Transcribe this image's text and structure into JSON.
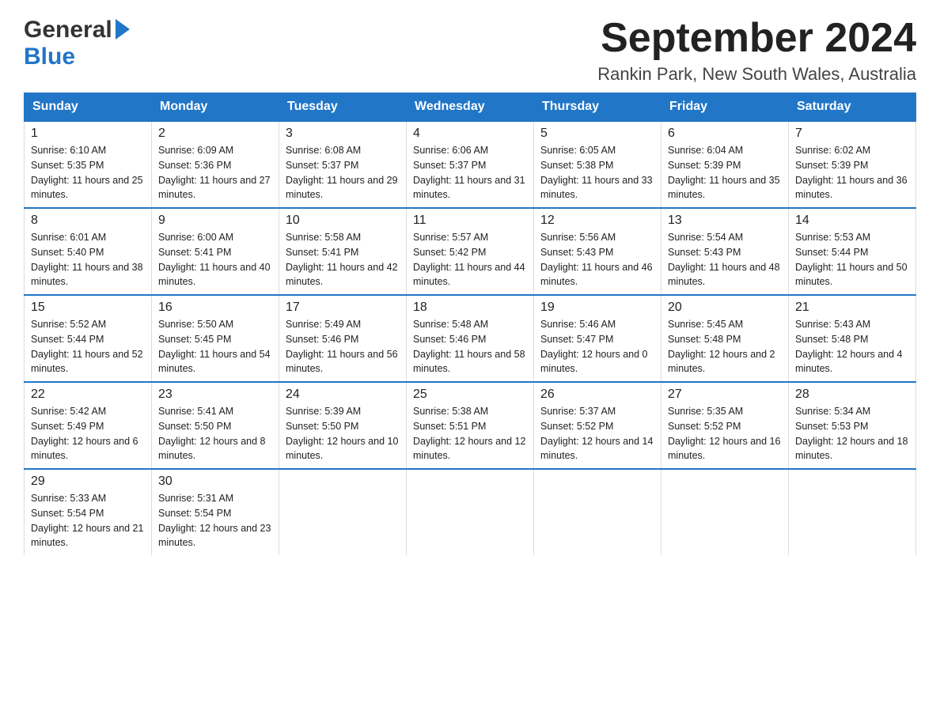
{
  "logo": {
    "general": "General",
    "blue": "Blue",
    "triangle": "▶"
  },
  "title": {
    "month_year": "September 2024",
    "location": "Rankin Park, New South Wales, Australia"
  },
  "weekdays": [
    "Sunday",
    "Monday",
    "Tuesday",
    "Wednesday",
    "Thursday",
    "Friday",
    "Saturday"
  ],
  "weeks": [
    [
      {
        "day": "1",
        "sunrise": "Sunrise: 6:10 AM",
        "sunset": "Sunset: 5:35 PM",
        "daylight": "Daylight: 11 hours and 25 minutes."
      },
      {
        "day": "2",
        "sunrise": "Sunrise: 6:09 AM",
        "sunset": "Sunset: 5:36 PM",
        "daylight": "Daylight: 11 hours and 27 minutes."
      },
      {
        "day": "3",
        "sunrise": "Sunrise: 6:08 AM",
        "sunset": "Sunset: 5:37 PM",
        "daylight": "Daylight: 11 hours and 29 minutes."
      },
      {
        "day": "4",
        "sunrise": "Sunrise: 6:06 AM",
        "sunset": "Sunset: 5:37 PM",
        "daylight": "Daylight: 11 hours and 31 minutes."
      },
      {
        "day": "5",
        "sunrise": "Sunrise: 6:05 AM",
        "sunset": "Sunset: 5:38 PM",
        "daylight": "Daylight: 11 hours and 33 minutes."
      },
      {
        "day": "6",
        "sunrise": "Sunrise: 6:04 AM",
        "sunset": "Sunset: 5:39 PM",
        "daylight": "Daylight: 11 hours and 35 minutes."
      },
      {
        "day": "7",
        "sunrise": "Sunrise: 6:02 AM",
        "sunset": "Sunset: 5:39 PM",
        "daylight": "Daylight: 11 hours and 36 minutes."
      }
    ],
    [
      {
        "day": "8",
        "sunrise": "Sunrise: 6:01 AM",
        "sunset": "Sunset: 5:40 PM",
        "daylight": "Daylight: 11 hours and 38 minutes."
      },
      {
        "day": "9",
        "sunrise": "Sunrise: 6:00 AM",
        "sunset": "Sunset: 5:41 PM",
        "daylight": "Daylight: 11 hours and 40 minutes."
      },
      {
        "day": "10",
        "sunrise": "Sunrise: 5:58 AM",
        "sunset": "Sunset: 5:41 PM",
        "daylight": "Daylight: 11 hours and 42 minutes."
      },
      {
        "day": "11",
        "sunrise": "Sunrise: 5:57 AM",
        "sunset": "Sunset: 5:42 PM",
        "daylight": "Daylight: 11 hours and 44 minutes."
      },
      {
        "day": "12",
        "sunrise": "Sunrise: 5:56 AM",
        "sunset": "Sunset: 5:43 PM",
        "daylight": "Daylight: 11 hours and 46 minutes."
      },
      {
        "day": "13",
        "sunrise": "Sunrise: 5:54 AM",
        "sunset": "Sunset: 5:43 PM",
        "daylight": "Daylight: 11 hours and 48 minutes."
      },
      {
        "day": "14",
        "sunrise": "Sunrise: 5:53 AM",
        "sunset": "Sunset: 5:44 PM",
        "daylight": "Daylight: 11 hours and 50 minutes."
      }
    ],
    [
      {
        "day": "15",
        "sunrise": "Sunrise: 5:52 AM",
        "sunset": "Sunset: 5:44 PM",
        "daylight": "Daylight: 11 hours and 52 minutes."
      },
      {
        "day": "16",
        "sunrise": "Sunrise: 5:50 AM",
        "sunset": "Sunset: 5:45 PM",
        "daylight": "Daylight: 11 hours and 54 minutes."
      },
      {
        "day": "17",
        "sunrise": "Sunrise: 5:49 AM",
        "sunset": "Sunset: 5:46 PM",
        "daylight": "Daylight: 11 hours and 56 minutes."
      },
      {
        "day": "18",
        "sunrise": "Sunrise: 5:48 AM",
        "sunset": "Sunset: 5:46 PM",
        "daylight": "Daylight: 11 hours and 58 minutes."
      },
      {
        "day": "19",
        "sunrise": "Sunrise: 5:46 AM",
        "sunset": "Sunset: 5:47 PM",
        "daylight": "Daylight: 12 hours and 0 minutes."
      },
      {
        "day": "20",
        "sunrise": "Sunrise: 5:45 AM",
        "sunset": "Sunset: 5:48 PM",
        "daylight": "Daylight: 12 hours and 2 minutes."
      },
      {
        "day": "21",
        "sunrise": "Sunrise: 5:43 AM",
        "sunset": "Sunset: 5:48 PM",
        "daylight": "Daylight: 12 hours and 4 minutes."
      }
    ],
    [
      {
        "day": "22",
        "sunrise": "Sunrise: 5:42 AM",
        "sunset": "Sunset: 5:49 PM",
        "daylight": "Daylight: 12 hours and 6 minutes."
      },
      {
        "day": "23",
        "sunrise": "Sunrise: 5:41 AM",
        "sunset": "Sunset: 5:50 PM",
        "daylight": "Daylight: 12 hours and 8 minutes."
      },
      {
        "day": "24",
        "sunrise": "Sunrise: 5:39 AM",
        "sunset": "Sunset: 5:50 PM",
        "daylight": "Daylight: 12 hours and 10 minutes."
      },
      {
        "day": "25",
        "sunrise": "Sunrise: 5:38 AM",
        "sunset": "Sunset: 5:51 PM",
        "daylight": "Daylight: 12 hours and 12 minutes."
      },
      {
        "day": "26",
        "sunrise": "Sunrise: 5:37 AM",
        "sunset": "Sunset: 5:52 PM",
        "daylight": "Daylight: 12 hours and 14 minutes."
      },
      {
        "day": "27",
        "sunrise": "Sunrise: 5:35 AM",
        "sunset": "Sunset: 5:52 PM",
        "daylight": "Daylight: 12 hours and 16 minutes."
      },
      {
        "day": "28",
        "sunrise": "Sunrise: 5:34 AM",
        "sunset": "Sunset: 5:53 PM",
        "daylight": "Daylight: 12 hours and 18 minutes."
      }
    ],
    [
      {
        "day": "29",
        "sunrise": "Sunrise: 5:33 AM",
        "sunset": "Sunset: 5:54 PM",
        "daylight": "Daylight: 12 hours and 21 minutes."
      },
      {
        "day": "30",
        "sunrise": "Sunrise: 5:31 AM",
        "sunset": "Sunset: 5:54 PM",
        "daylight": "Daylight: 12 hours and 23 minutes."
      },
      null,
      null,
      null,
      null,
      null
    ]
  ]
}
